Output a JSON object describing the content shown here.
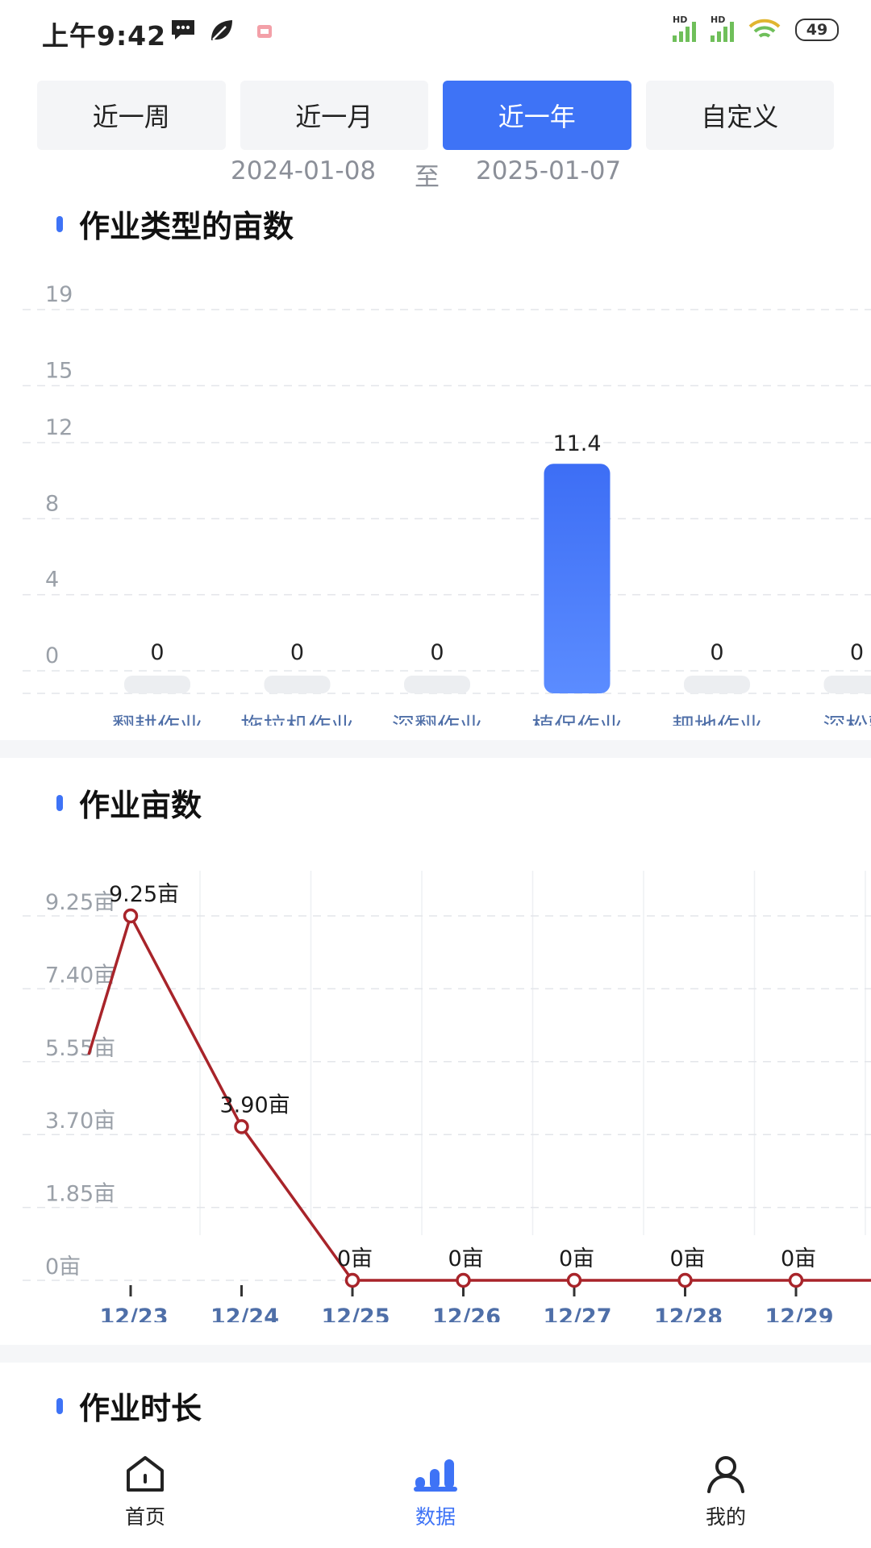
{
  "status_bar": {
    "time": "上午9:42",
    "battery": "49",
    "signal_labels": [
      "HD",
      "HD"
    ]
  },
  "period_tabs": [
    {
      "label": "近一周",
      "active": false
    },
    {
      "label": "近一月",
      "active": false
    },
    {
      "label": "近一年",
      "active": true
    },
    {
      "label": "自定义",
      "active": false
    }
  ],
  "date_range": {
    "start": "2024-01-08",
    "separator": "至",
    "end": "2025-01-07"
  },
  "sections": {
    "acreage_by_type": {
      "title": "作业类型的亩数"
    },
    "acreage_trend": {
      "title": "作业亩数"
    },
    "duration": {
      "title": "作业时长"
    }
  },
  "colors": {
    "accent": "#3e73f6",
    "line": "#a8242a",
    "grid": "#e3e5ea"
  },
  "chart_data": [
    {
      "type": "bar",
      "title": "作业类型的亩数",
      "categories": [
        "翻耕作业",
        "拖拉机作业",
        "深翻作业",
        "植保作业",
        "耙地作业",
        "深松整"
      ],
      "values": [
        0,
        0,
        0,
        11.4,
        0,
        0
      ],
      "value_labels": [
        "0",
        "0",
        "0",
        "11.4",
        "0",
        "0"
      ],
      "y_ticks": [
        "0",
        "4",
        "8",
        "12",
        "15",
        "19"
      ],
      "ylim": [
        0,
        19
      ],
      "grid": true
    },
    {
      "type": "line",
      "title": "作业亩数",
      "x": [
        "12/23",
        "12/24",
        "12/25",
        "12/26",
        "12/27",
        "12/28",
        "12/29"
      ],
      "values": [
        9.25,
        3.9,
        0,
        0,
        0,
        0,
        0
      ],
      "point_labels": [
        "9.25亩",
        "3.90亩",
        "0亩",
        "0亩",
        "0亩",
        "0亩",
        "0亩"
      ],
      "y_ticks": [
        "0亩",
        "1.85亩",
        "3.70亩",
        "5.55亩",
        "7.40亩",
        "9.25亩"
      ],
      "ylim": [
        0,
        9.25
      ],
      "grid": true
    }
  ],
  "bottom_nav": [
    {
      "label": "首页",
      "icon": "home-icon",
      "active": false
    },
    {
      "label": "数据",
      "icon": "bar-chart-icon",
      "active": true
    },
    {
      "label": "我的",
      "icon": "person-icon",
      "active": false
    }
  ]
}
